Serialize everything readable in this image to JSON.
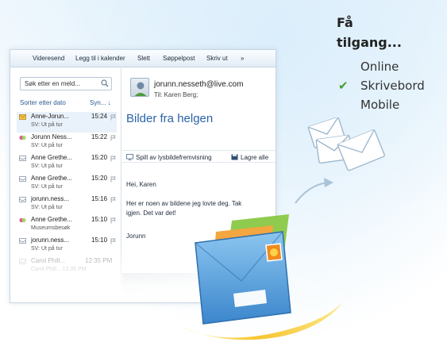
{
  "promo": {
    "title": "Få\ntilgang...",
    "platforms": [
      {
        "label": "Online",
        "checked": false
      },
      {
        "label": "Skrivebord",
        "checked": true
      },
      {
        "label": "Mobile",
        "checked": false
      }
    ]
  },
  "toolbar": {
    "items": [
      "Videresend",
      "Legg til i kalender",
      "Slett",
      "Søppelpost",
      "Skriv ut",
      "»"
    ]
  },
  "msglist": {
    "search_placeholder": "Søk etter en meld...",
    "sort_label": "Sorter etter dato",
    "sync_label": "Syn... ↓",
    "messages": [
      {
        "from": "Anne-Jorun...",
        "time": "15:24",
        "subject": "SV: Ut på tur",
        "icon": "envelope-icon",
        "selected": true
      },
      {
        "from": "Jorunn Ness...",
        "time": "15:22",
        "subject": "SV: Ut på tur",
        "icon": "messenger-icon",
        "selected": false
      },
      {
        "from": "Anne Grethe...",
        "time": "15:20",
        "subject": "SV: Ut på tur",
        "icon": "envelope-open-icon",
        "selected": false
      },
      {
        "from": "Anne Grethe...",
        "time": "15:20",
        "subject": "SV: Ut på tur",
        "icon": "envelope-open-icon",
        "selected": false
      },
      {
        "from": "jorunn.ness...",
        "time": "15:16",
        "subject": "SV: Ut på tur",
        "icon": "envelope-open-icon",
        "selected": false
      },
      {
        "from": "Anne Grethe...",
        "time": "15:10",
        "subject": "Museumsbesøk",
        "icon": "messenger-icon",
        "selected": false
      },
      {
        "from": "jorunn.ness...",
        "time": "15:10",
        "subject": "SV: Ut på tur",
        "icon": "envelope-open-icon",
        "selected": false
      },
      {
        "from": "Carol Phill...",
        "time": "12:35 PM",
        "subject": "Carol Phill... 12:35 PM",
        "icon": "envelope-open-icon",
        "selected": false
      }
    ]
  },
  "reading": {
    "sender": "jorunn.nesseth@live.com",
    "to": "Til: Karen Berg;",
    "subject": "Bilder fra helgen",
    "actions": [
      "Spill av lysbildefremvisning",
      "Lagre alle"
    ],
    "greeting": "Hei, Karen",
    "body_lines": [
      "Her er noen av bildene jeg lovte deg. Tak",
      "igjen. Det var det!"
    ],
    "signature": "Jorunn"
  },
  "colors": {
    "accent": "#2b63a8",
    "check": "#43a12f",
    "envelope_front": "#5aa2de",
    "envelope_green": "#8fcb4f",
    "envelope_orange": "#f4a640"
  }
}
